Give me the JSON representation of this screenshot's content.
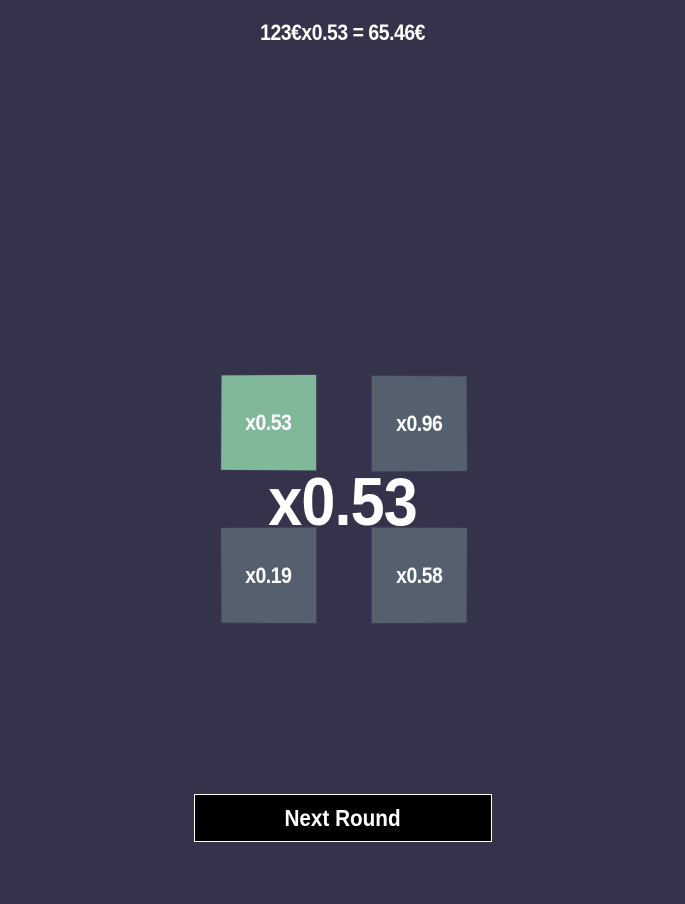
{
  "header": {
    "result_text": "123€x0.53 = 65.46€"
  },
  "tiles": [
    {
      "label": "x0.53",
      "selected": true
    },
    {
      "label": "x0.96",
      "selected": false
    },
    {
      "label": "x0.19",
      "selected": false
    },
    {
      "label": "x0.58",
      "selected": false
    }
  ],
  "result": {
    "multiplier": "x0.53"
  },
  "actions": {
    "next_round_label": "Next Round"
  },
  "colors": {
    "background": "#34334b",
    "tile": "#55606f",
    "tile_selected": "#7fb99a",
    "button": "#000000",
    "text": "#ffffff"
  }
}
